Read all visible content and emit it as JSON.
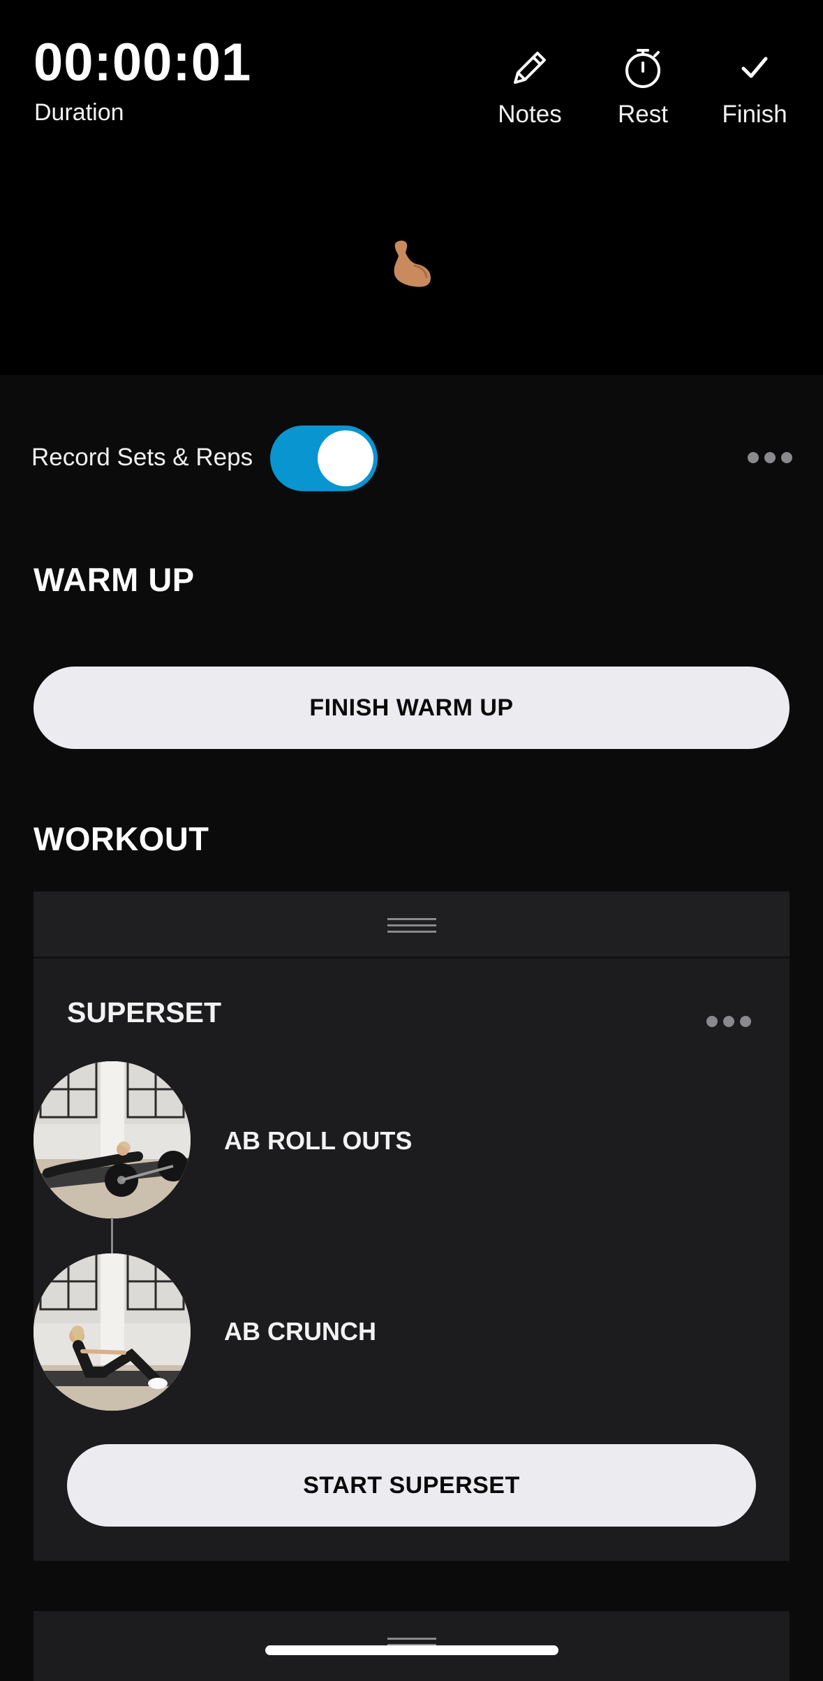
{
  "timer": {
    "value": "00:00:01",
    "label": "Duration"
  },
  "actions": {
    "notes": "Notes",
    "rest": "Rest",
    "finish": "Finish"
  },
  "emoji": "flexed-biceps",
  "record": {
    "label": "Record Sets & Reps",
    "enabled": true
  },
  "warmup": {
    "title": "WARM UP",
    "button": "FINISH WARM UP"
  },
  "workout": {
    "title": "WORKOUT",
    "superset": {
      "title": "SUPERSET",
      "exercises": [
        {
          "name": "AB ROLL OUTS"
        },
        {
          "name": "AB CRUNCH"
        }
      ],
      "button": "START SUPERSET"
    }
  },
  "colors": {
    "accent": "#0895d0",
    "background": "#0b0b0c",
    "card": "#1c1c1e",
    "button": "#ebebf0"
  }
}
